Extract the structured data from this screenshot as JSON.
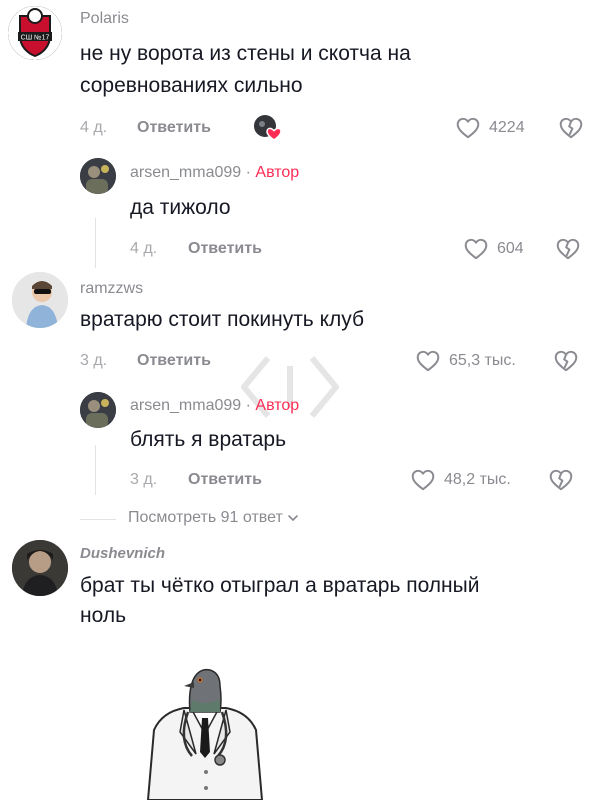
{
  "comments": [
    {
      "username": "Polaris",
      "text_line1": "не ну ворота из стены и скотча на",
      "text_line2": "соревнованиях сильно",
      "age": "4 д.",
      "reply_label": "Ответить",
      "likes": "4224",
      "badge": "СШ №17"
    },
    {
      "username": "arsen_mma099",
      "separator": "·",
      "author_label": "Автор",
      "text": "да тижоло",
      "age": "4 д.",
      "reply_label": "Ответить",
      "likes": "604"
    },
    {
      "username": "ramzzws",
      "text": "вратарю стоит покинуть клуб",
      "age": "3 д.",
      "reply_label": "Ответить",
      "likes": "65,3 тыс."
    },
    {
      "username": "arsen_mma099",
      "separator": "·",
      "author_label": "Автор",
      "text": "блять я вратарь",
      "age": "3 д.",
      "reply_label": "Ответить",
      "likes": "48,2 тыс."
    },
    {
      "username": "Dushevnich",
      "text_line1": "брат ты чётко отыграл а вратарь полный",
      "text_line2": "ноль"
    }
  ],
  "view_more": {
    "label": "Посмотреть 91 ответ"
  },
  "colors": {
    "author": "#fe2c55",
    "text": "#161823",
    "muted": "#8a8b91"
  },
  "icons": [
    "heart-icon",
    "broken-heart-icon",
    "chevron-down-icon",
    "creator-liked-icon"
  ]
}
